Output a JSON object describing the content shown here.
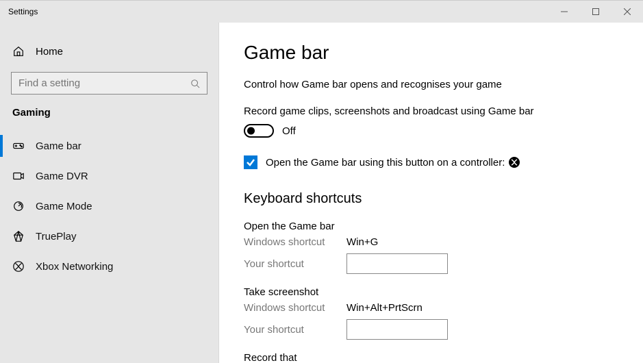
{
  "window": {
    "title": "Settings"
  },
  "sidebar": {
    "home_label": "Home",
    "search_placeholder": "Find a setting",
    "section_label": "Gaming",
    "items": [
      {
        "label": "Game bar"
      },
      {
        "label": "Game DVR"
      },
      {
        "label": "Game Mode"
      },
      {
        "label": "TruePlay"
      },
      {
        "label": "Xbox Networking"
      }
    ]
  },
  "page": {
    "title": "Game bar",
    "description": "Control how Game bar opens and recognises your game",
    "toggle_description": "Record game clips, screenshots and broadcast using Game bar",
    "toggle_state_label": "Off",
    "checkbox_label": "Open the Game bar using this button on a controller:",
    "section_shortcuts": "Keyboard shortcuts",
    "shortcuts": [
      {
        "title": "Open the Game bar",
        "windows_label": "Windows shortcut",
        "windows_value": "Win+G",
        "your_label": "Your shortcut",
        "your_value": ""
      },
      {
        "title": "Take screenshot",
        "windows_label": "Windows shortcut",
        "windows_value": "Win+Alt+PrtScrn",
        "your_label": "Your shortcut",
        "your_value": ""
      }
    ],
    "cutoff_text": "Record that"
  }
}
